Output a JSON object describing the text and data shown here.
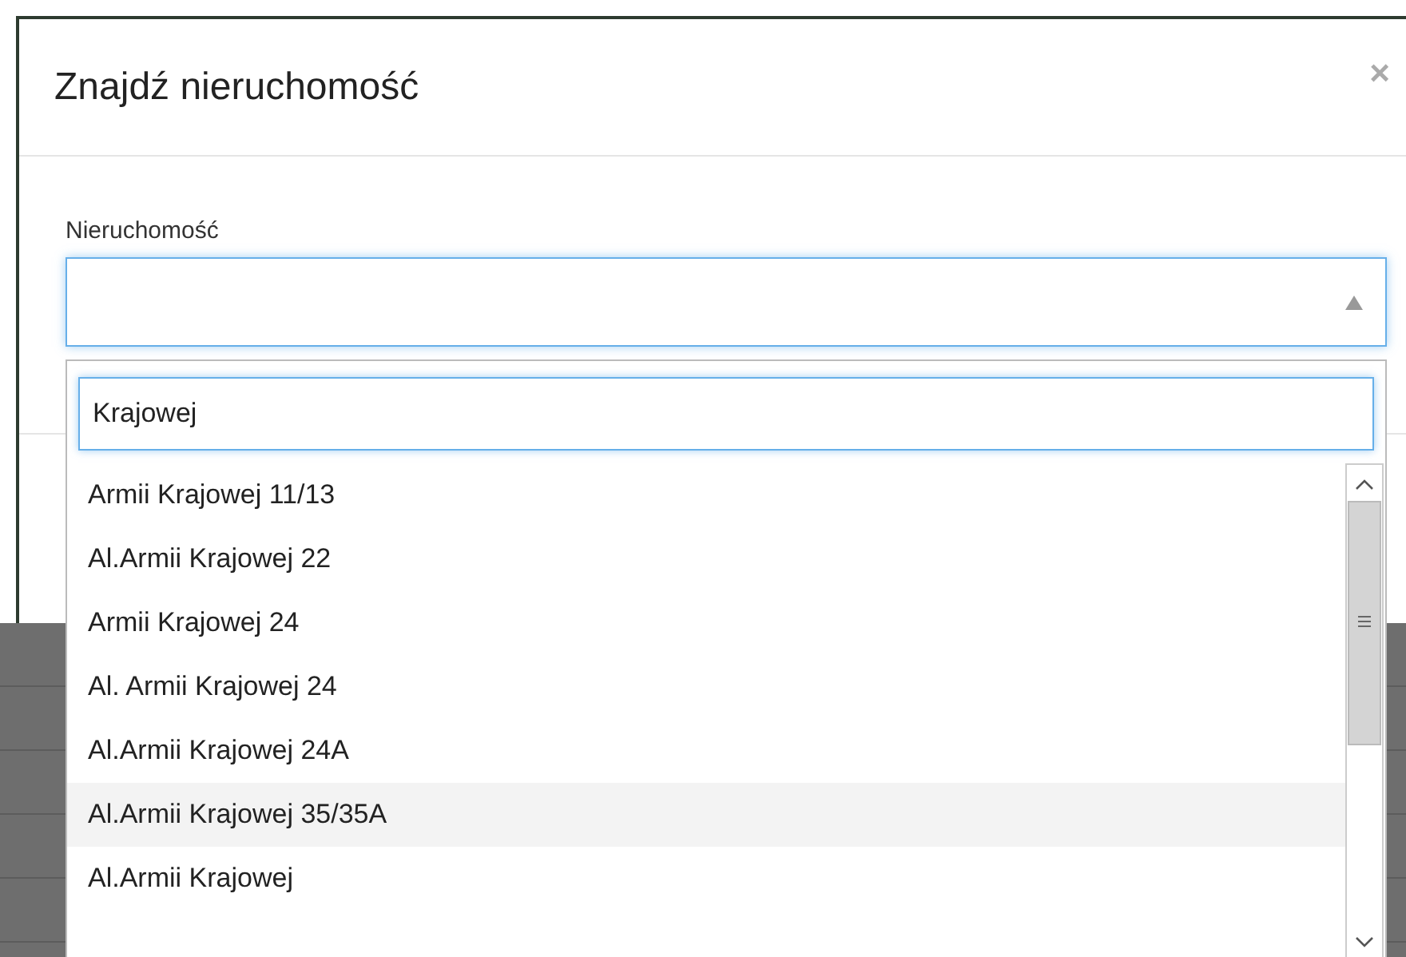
{
  "modal": {
    "title": "Znajdź nieruchomość",
    "close": "×"
  },
  "field": {
    "label": "Nieruchomość",
    "expanded": true
  },
  "dropdown": {
    "search": "Krajowej",
    "options": [
      {
        "label": "Armii Krajowej 11/13",
        "selected": false
      },
      {
        "label": "Al.Armii Krajowej 22",
        "selected": false
      },
      {
        "label": "Armii Krajowej 24",
        "selected": false
      },
      {
        "label": "Al. Armii Krajowej 24",
        "selected": false
      },
      {
        "label": "Al.Armii Krajowej 24A",
        "selected": false
      },
      {
        "label": "Al.Armii Krajowej 35/35A",
        "selected": true
      },
      {
        "label": "Al.Armii Krajowej",
        "selected": false
      }
    ]
  }
}
